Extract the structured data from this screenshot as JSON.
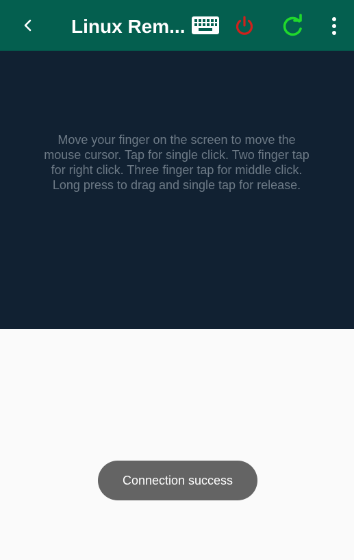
{
  "app": {
    "title": "Linux Rem..."
  },
  "toolbar": {
    "back_icon": "chevron-left-icon",
    "keyboard_icon": "keyboard-icon",
    "power_icon": "power-icon",
    "refresh_icon": "refresh-icon",
    "menu_icon": "more-vert-icon"
  },
  "colors": {
    "toolbar_bg": "#045f4f",
    "touchpad_bg": "#112132",
    "power": "#d0211c",
    "refresh": "#20d82c",
    "toast_bg": "#646464",
    "hint_text": "#6d7a86"
  },
  "touchpad": {
    "hint": "Move your finger on the screen to move the mouse cursor. Tap for single click. Two finger tap for right click. Three finger tap for middle click. Long press to drag and single tap for release."
  },
  "toast": {
    "message": "Connection success"
  }
}
